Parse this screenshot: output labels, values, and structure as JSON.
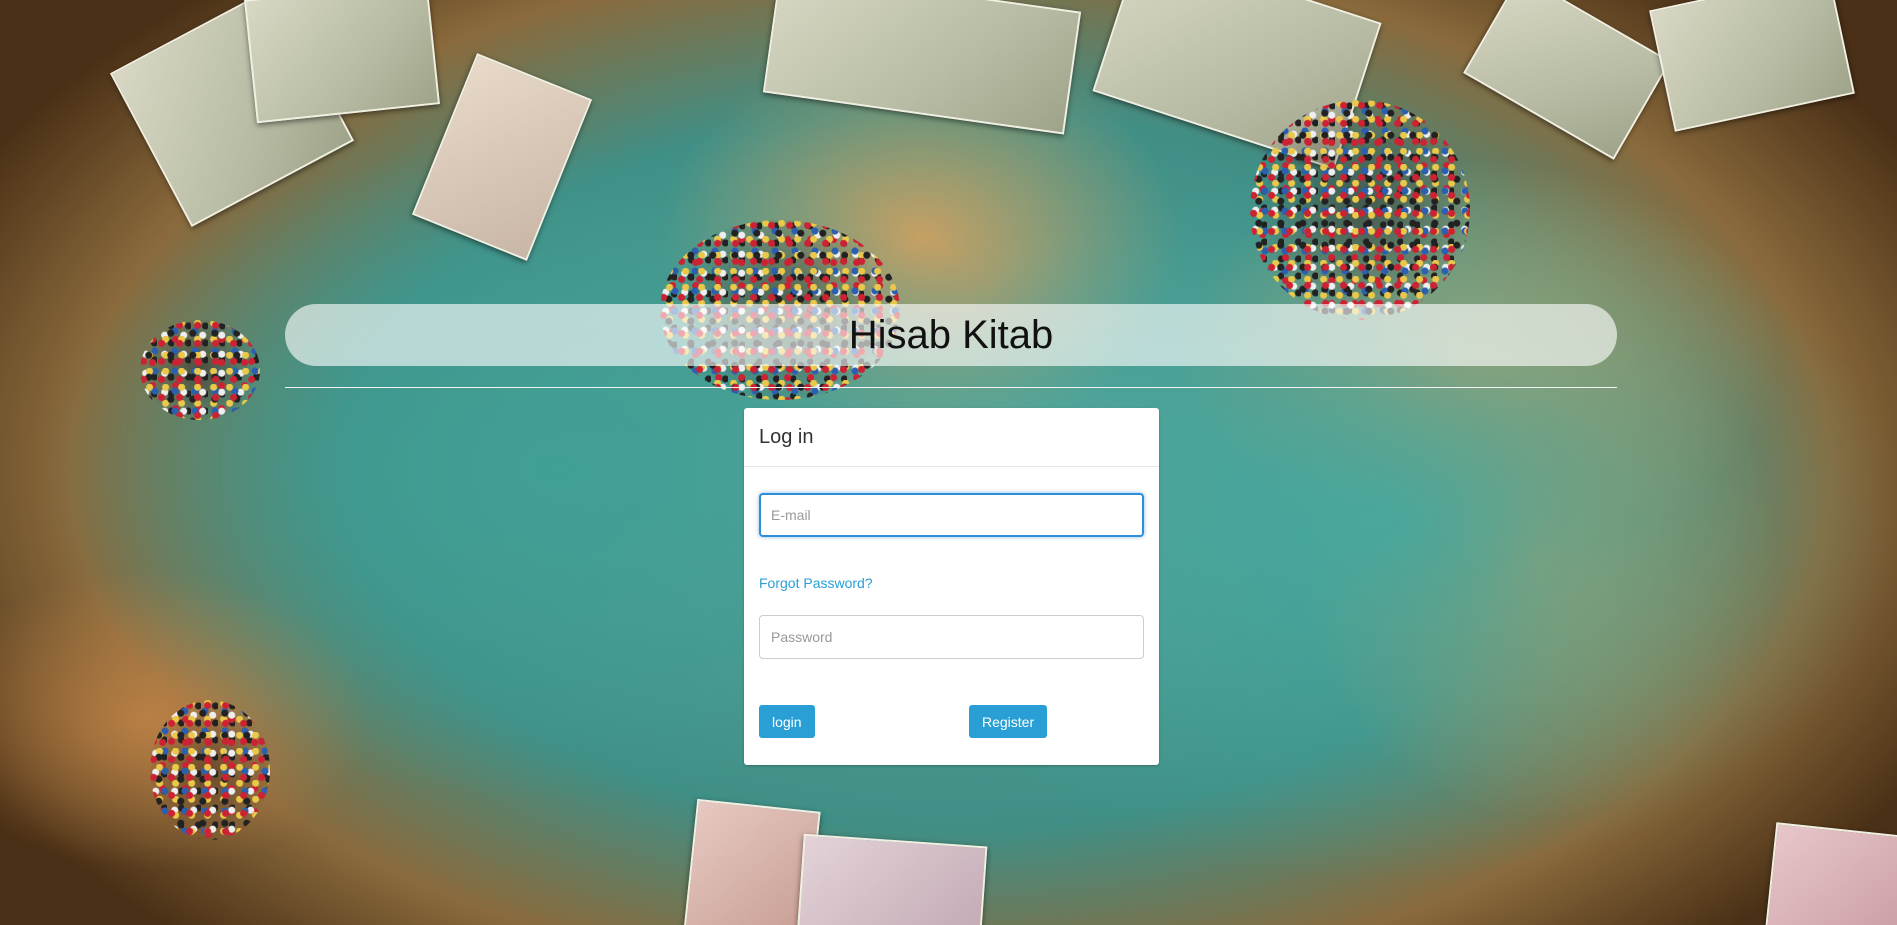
{
  "app": {
    "title": "Hisab Kitab"
  },
  "login_panel": {
    "heading": "Log in",
    "email_placeholder": "E-mail",
    "email_value": "",
    "forgot_password_link": "Forgot Password?",
    "password_placeholder": "Password",
    "password_value": "",
    "login_button": "login",
    "register_button": "Register"
  },
  "colors": {
    "accent": "#2a9fd6",
    "focus_border": "#2f8ed8",
    "title_bar": "rgba(255,255,255,0.62)"
  },
  "background": {
    "description_icon": "world-map-with-banknotes-background"
  }
}
